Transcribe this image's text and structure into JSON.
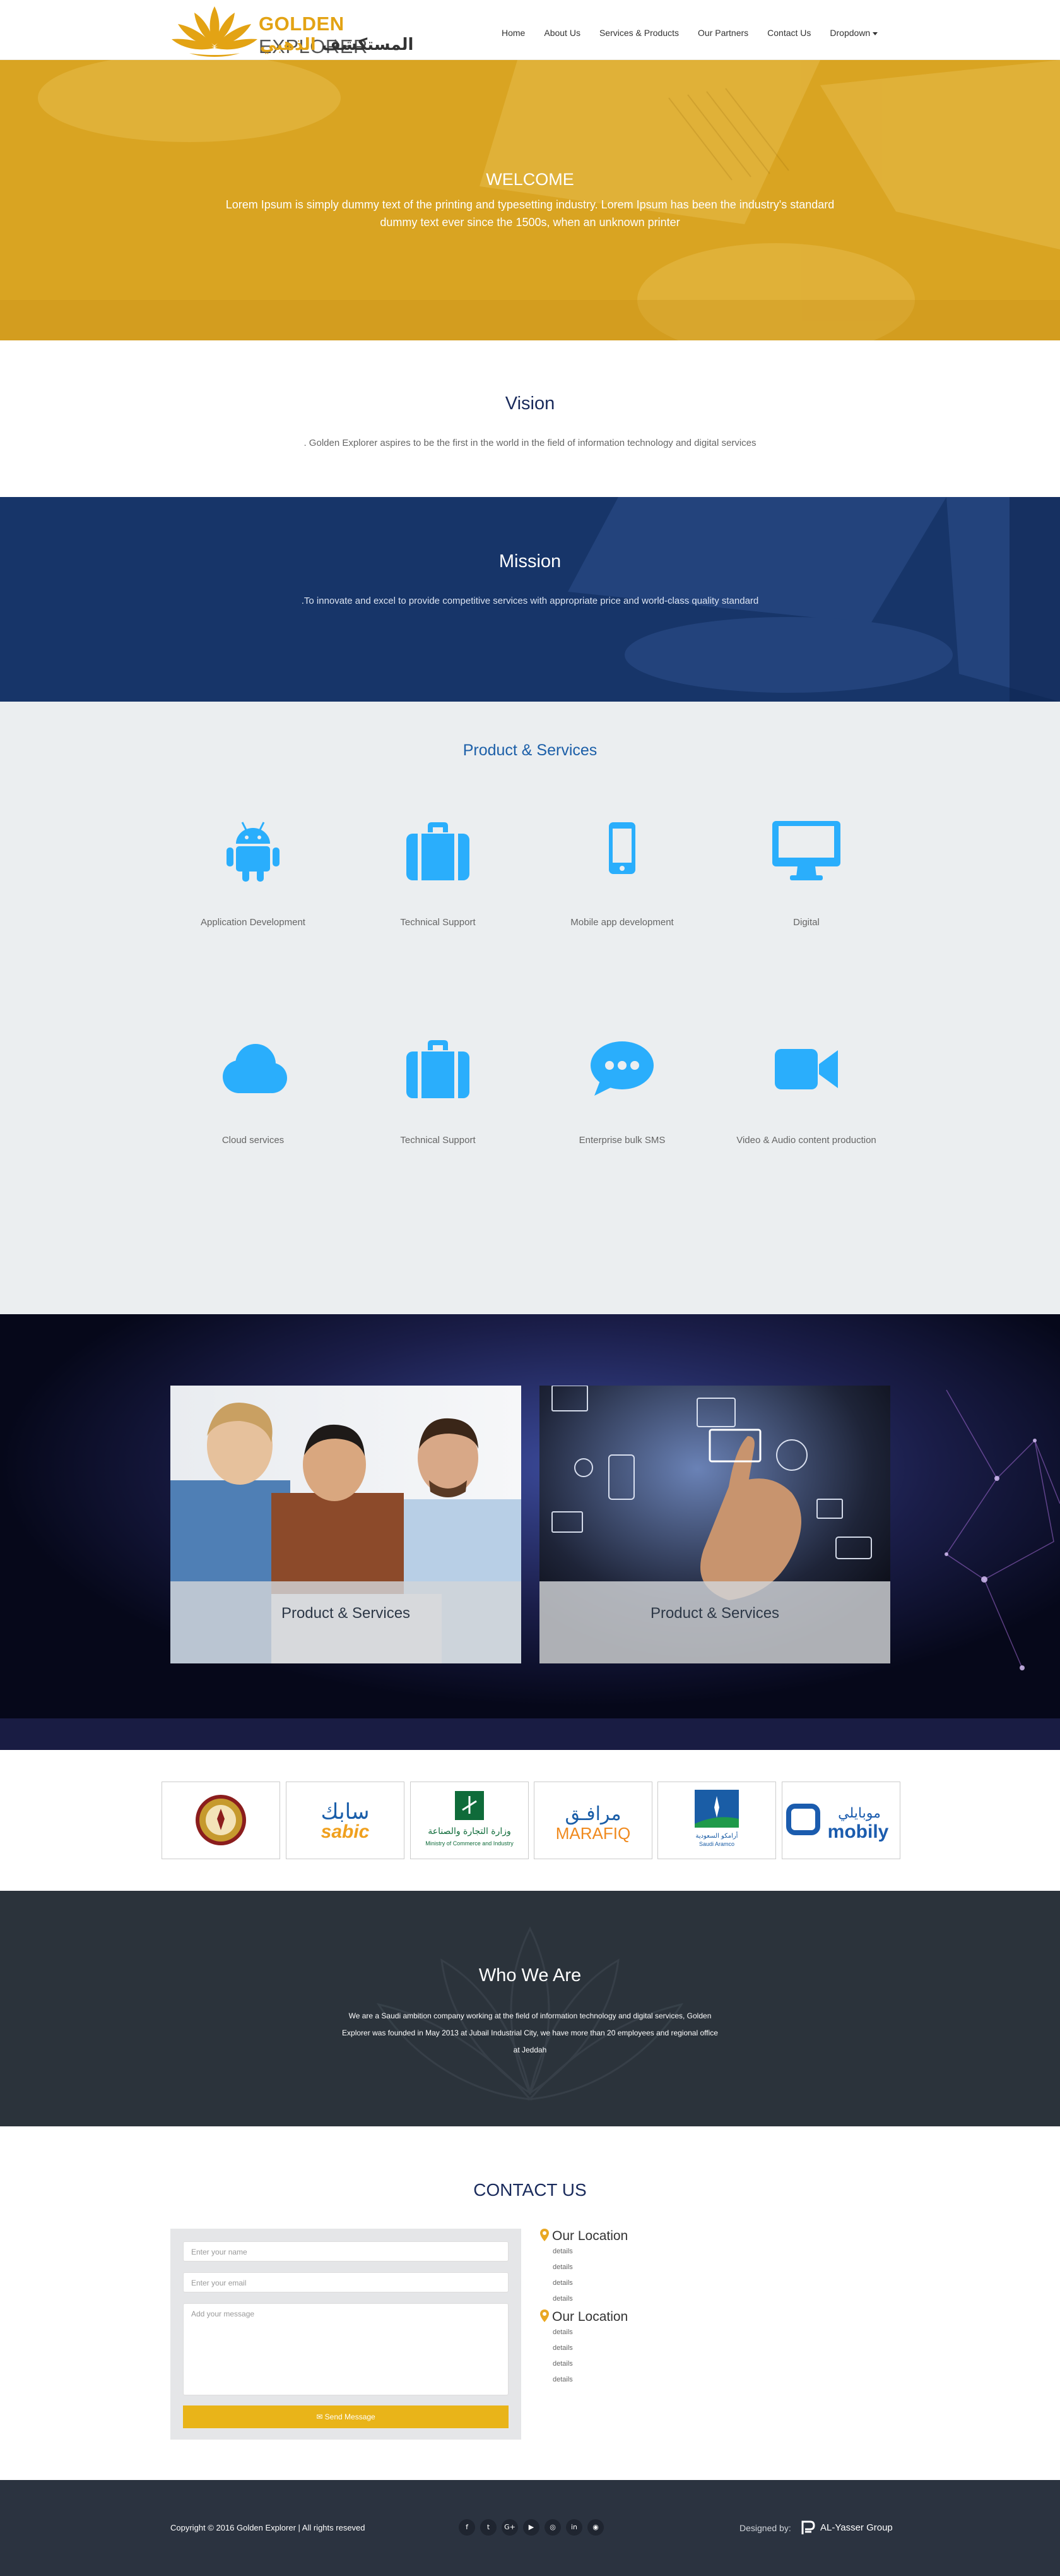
{
  "navbar": {
    "logo": {
      "brand_bold": "GOLDEN",
      "brand_thin": "EXPLORER",
      "arabic_dark": "المستكشف",
      "arabic_gold": "الذهبي"
    },
    "menu": [
      {
        "label": "Home"
      },
      {
        "label": "About Us"
      },
      {
        "label": "Services & Products"
      },
      {
        "label": "Our Partners"
      },
      {
        "label": "Contact Us"
      },
      {
        "label": "Dropdown"
      }
    ]
  },
  "hero": {
    "title": "WELCOME",
    "text": "Lorem Ipsum is simply dummy text of the printing and typesetting industry. Lorem Ipsum has been the industry's standard dummy text ever since the 1500s, when an unknown printer"
  },
  "vision": {
    "title": "Vision",
    "text": ". Golden Explorer aspires to be the first in the world in the field of information technology and digital services"
  },
  "mission": {
    "title": "Mission",
    "text": ".To innovate and excel to provide competitive services with appropriate price and world-class quality standard"
  },
  "products": {
    "title": "Product & Services",
    "items": [
      {
        "label": "Application Development",
        "icon": "android-icon"
      },
      {
        "label": "Technical Support",
        "icon": "briefcase-icon"
      },
      {
        "label": "Mobile app development",
        "icon": "mobile-icon"
      },
      {
        "label": "Digital",
        "icon": "desktop-icon"
      },
      {
        "label": "Cloud services",
        "icon": "cloud-icon"
      },
      {
        "label": "Technical Support",
        "icon": "briefcase-icon"
      },
      {
        "label": "Enterprise bulk SMS",
        "icon": "chat-bubble-icon"
      },
      {
        "label": "Video & Audio content production",
        "icon": "video-camera-icon"
      }
    ],
    "icon_color": "#2aaefc"
  },
  "showcase": {
    "cards": [
      {
        "caption": "Product & Services"
      },
      {
        "caption": "Product & Services"
      }
    ]
  },
  "partners": {
    "logos": [
      {
        "name": "emblem-logo"
      },
      {
        "name": "sabic-logo",
        "text_ar": "سابك",
        "text_en": "sabic"
      },
      {
        "name": "ministry-commerce-logo",
        "text_ar": "وزارة التجارة والصناعة",
        "text_en": "Ministry of Commerce and Industry"
      },
      {
        "name": "marafiq-logo",
        "text_ar": "مرافـق",
        "text_en": "MARAFIQ"
      },
      {
        "name": "saudi-aramco-logo",
        "text_ar": "أرامكو السعودية",
        "text_en": "Saudi Aramco"
      },
      {
        "name": "mobily-logo",
        "text_ar": "موبايلي",
        "text_en": "mobily"
      }
    ]
  },
  "who": {
    "title": "Who We Are",
    "text": "We are a Saudi ambition company working at the field of information technology and digital services, Golden Explorer was founded in May 2013 at Jubail Industrial City, we have more than 20 employees and regional office at Jeddah"
  },
  "contact": {
    "title": "CONTACT US",
    "name_placeholder": "Enter your name",
    "email_placeholder": "Enter your email",
    "message_placeholder": "Add  your message",
    "send_label": "Send Message",
    "locations": [
      {
        "title": "Our Location",
        "details": [
          "details",
          "details",
          "details",
          "details"
        ]
      },
      {
        "title": "Our Location",
        "details": [
          "details",
          "details",
          "details",
          "details"
        ]
      }
    ]
  },
  "footer": {
    "copyright": "Copyright © 2016 Golden Explorer | All rights reseved",
    "social": [
      {
        "icon": "facebook-icon",
        "glyph": "f"
      },
      {
        "icon": "twitter-icon",
        "glyph": "t"
      },
      {
        "icon": "google-plus-icon",
        "glyph": "G+"
      },
      {
        "icon": "youtube-icon",
        "glyph": "▶"
      },
      {
        "icon": "instagram-icon",
        "glyph": "◎"
      },
      {
        "icon": "linkedin-icon",
        "glyph": "in"
      },
      {
        "icon": "rss-icon",
        "glyph": "◉"
      }
    ],
    "designed_by": "Designed by:",
    "designer": "AL-Yasser Group"
  },
  "colors": {
    "gold": "#e3a314",
    "navy": "#173569",
    "dark": "#2b333b",
    "footer": "#2b3340",
    "button": "#e9b419"
  }
}
